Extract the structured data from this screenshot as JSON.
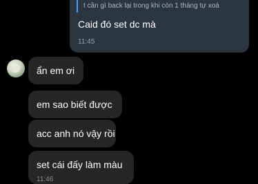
{
  "chat": {
    "outgoing": {
      "reply_quote": "t cần gì back lại trong khi còn 1 tháng tự xoá",
      "text": "Caid đó set dc mà",
      "time": "11:45"
    },
    "incoming": [
      {
        "text": "ẩn em ơi"
      },
      {
        "text": "em sao biết được"
      },
      {
        "text": "acc anh nó vậy rồi"
      },
      {
        "text": "set cái đấy làm màu",
        "time": "11:46"
      }
    ],
    "colors": {
      "background": "#000000",
      "outgoing_bubble": "#2b3540",
      "incoming_bubble": "#262626",
      "reply_accent": "#4d96ff"
    }
  }
}
